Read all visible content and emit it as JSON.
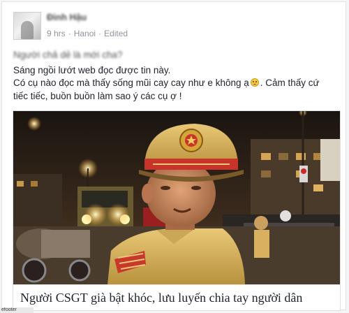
{
  "post": {
    "author": "Đinh Hậu",
    "time": "9 hrs",
    "separator": "·",
    "location": "Hanoi",
    "edited": "Edited",
    "line1": "Người chả dẻ là mới cha?",
    "line2": "Sáng ngồi lướt web đọc được tin này.",
    "line3_a": "Có cụ nào đọc mà thấy sống mũi cay cay như e không ạ",
    "line3_b": ". Cảm thấy cứ",
    "line4": "tiếc tiếc, buồn buồn làm sao ý các cụ ợ !",
    "emoji_icon": "frown-face-icon"
  },
  "attachment": {
    "caption": "Người CSGT già bật khóc, lưu luyến chia tay người dân"
  },
  "status_bar": {
    "text": "efooter"
  },
  "colors": {
    "text": "#1d2129",
    "meta": "#90949c",
    "uniform": "#d9b55a",
    "cap_band": "#c8342a"
  }
}
